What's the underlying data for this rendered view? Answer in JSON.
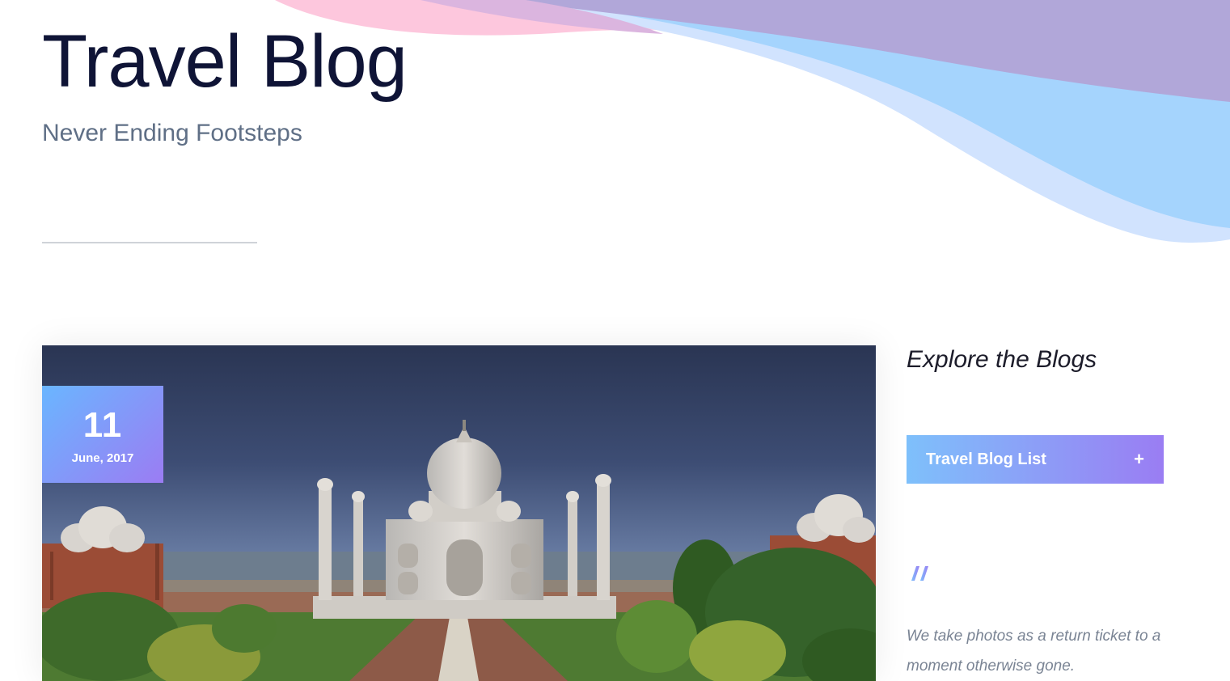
{
  "hero": {
    "title": "Travel Blog",
    "subtitle": "Never Ending Footsteps"
  },
  "post": {
    "date_day": "11",
    "date_month_year": "June, 2017",
    "image_icon": "taj-mahal-photo"
  },
  "sidebar": {
    "heading": "Explore the Blogs",
    "blog_list_button": {
      "label": "Travel Blog List",
      "icon": "plus-icon",
      "symbol": "+"
    },
    "quote_icon": "quote-mark-icon",
    "quote": "We take photos as a return ticket to a moment otherwise gone."
  },
  "colors": {
    "title": "#0f1436",
    "subtitle": "#5f6f86",
    "gradient_start": "#6ab6ff",
    "gradient_end": "#9b7cf3",
    "wave_purple": "#b0a6d8",
    "wave_blue": "#a6d3fd",
    "wave_pink": "#fdc5dc",
    "quote_text": "#7a8494"
  }
}
